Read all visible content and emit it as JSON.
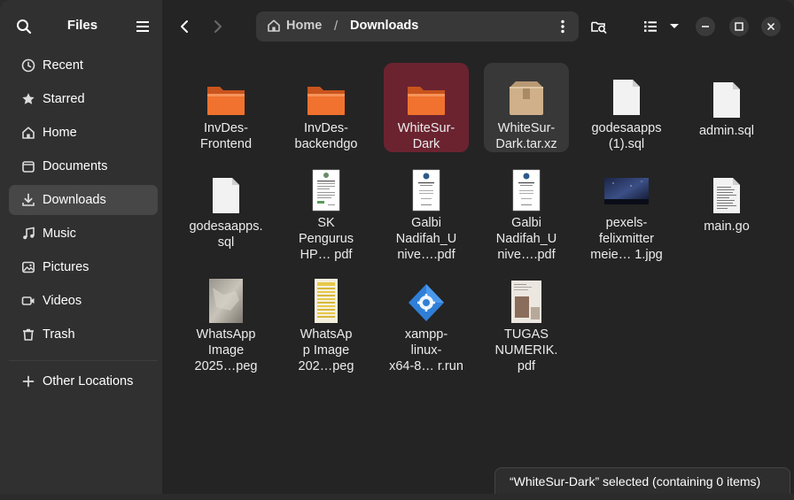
{
  "sidebar": {
    "title": "Files",
    "places": [
      {
        "label": "Recent",
        "icon": "clock-icon"
      },
      {
        "label": "Starred",
        "icon": "star-icon"
      },
      {
        "label": "Home",
        "icon": "home-icon"
      },
      {
        "label": "Documents",
        "icon": "document-icon"
      },
      {
        "label": "Downloads",
        "icon": "download-icon"
      },
      {
        "label": "Music",
        "icon": "music-icon"
      },
      {
        "label": "Pictures",
        "icon": "pictures-icon"
      },
      {
        "label": "Videos",
        "icon": "videos-icon"
      },
      {
        "label": "Trash",
        "icon": "trash-icon"
      }
    ],
    "other_locations": "Other Locations"
  },
  "path": {
    "home": "Home",
    "separator": "/",
    "current": "Downloads"
  },
  "files": [
    {
      "label": "InvDes-\nFrontend",
      "kind": "folder"
    },
    {
      "label": "InvDes-\nbackendgo",
      "kind": "folder"
    },
    {
      "label": "WhiteSur-\nDark",
      "kind": "folder",
      "state": "selected"
    },
    {
      "label": "WhiteSur-\nDark.tar.xz",
      "kind": "archive",
      "state": "hover"
    },
    {
      "label": "godesaapps\n(1).sql",
      "kind": "blank-file"
    },
    {
      "label": "admin.sql",
      "kind": "blank-file"
    },
    {
      "label": "godesaapps.\nsql",
      "kind": "blank-file"
    },
    {
      "label": "SK\nPengurus\nHP…  pdf",
      "kind": "pdf-doc"
    },
    {
      "label": "Galbi\nNadifah_U\nnive….pdf",
      "kind": "pdf-doc"
    },
    {
      "label": "Galbi\nNadifah_U\nnive….pdf",
      "kind": "pdf-doc"
    },
    {
      "label": "pexels-\nfelixmitter\nmeie… 1.jpg",
      "kind": "photo-night"
    },
    {
      "label": "main.go",
      "kind": "text-file"
    },
    {
      "label": "WhatsApp\nImage\n2025…peg",
      "kind": "photo-gray"
    },
    {
      "label": "WhatsAp\np Image\n202…peg",
      "kind": "photo-yellow"
    },
    {
      "label": "xampp-\nlinux-\nx64-8…  r.run",
      "kind": "installer"
    },
    {
      "label": "TUGAS\nNUMERIK.\npdf",
      "kind": "pdf-scan"
    }
  ],
  "status": "“WhiteSur-Dark” selected  (containing 0 items)",
  "colors": {
    "folder": "#f0722e",
    "selected": "#6b2330",
    "window": "#242424",
    "sidebar": "#303030"
  }
}
